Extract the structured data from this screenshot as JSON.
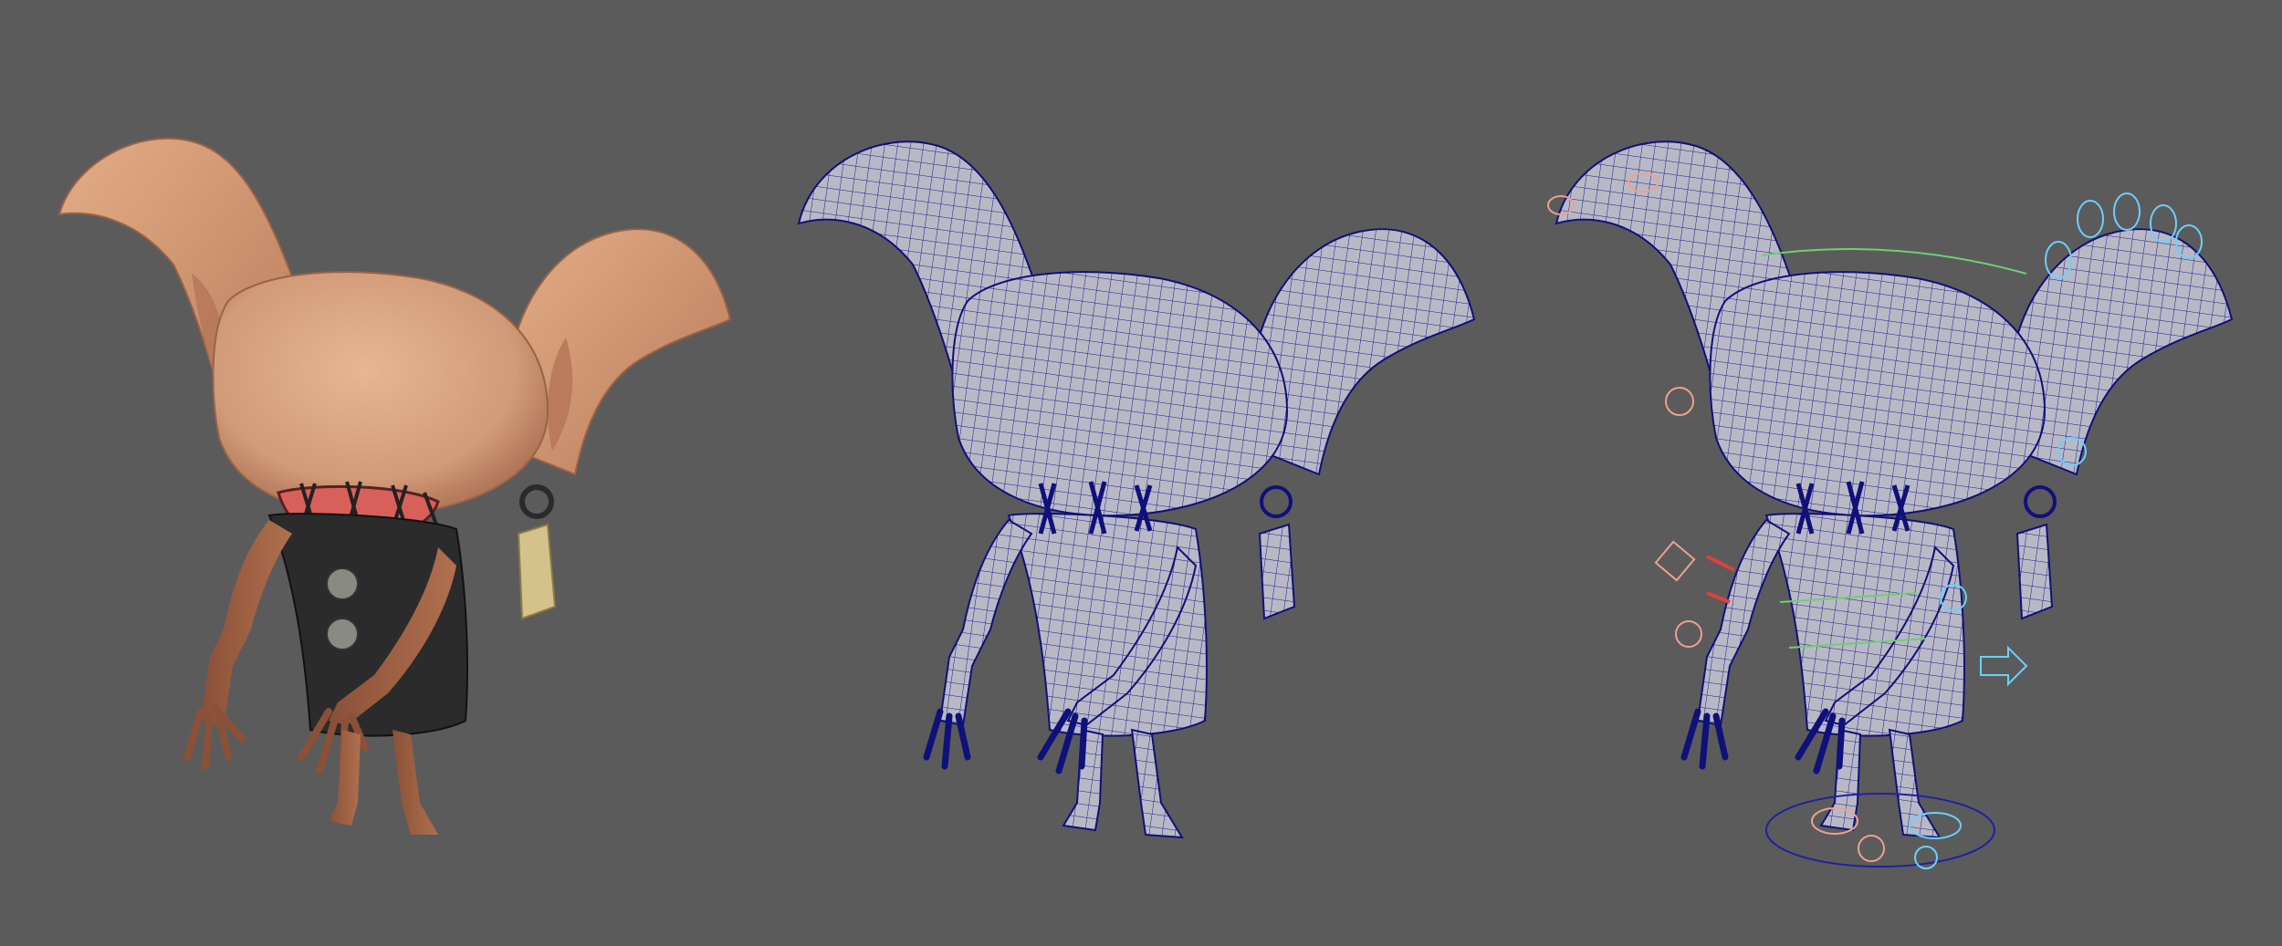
{
  "scene": {
    "background": "#5b5b5b",
    "views": [
      {
        "id": "render",
        "kind": "shaded-render"
      },
      {
        "id": "wireframe",
        "kind": "wireframe-mesh"
      },
      {
        "id": "rig",
        "kind": "wireframe-with-rig-controls"
      }
    ]
  },
  "colors": {
    "skin": "#d9a07a",
    "skin_shadow": "#b07050",
    "ear_inner": "#c98a6c",
    "shirt": "#2b2b2b",
    "mouth": "#d8605a",
    "tag": "#d4c28a",
    "mesh_fill": "#b9b9c6",
    "mesh_line": "#1a1a8c",
    "rig_cyan": "#6ad0ff",
    "rig_salmon": "#f0a090",
    "rig_green": "#6fcf6f",
    "rig_red": "#e04040",
    "rig_blue_ring": "#2020a0"
  }
}
